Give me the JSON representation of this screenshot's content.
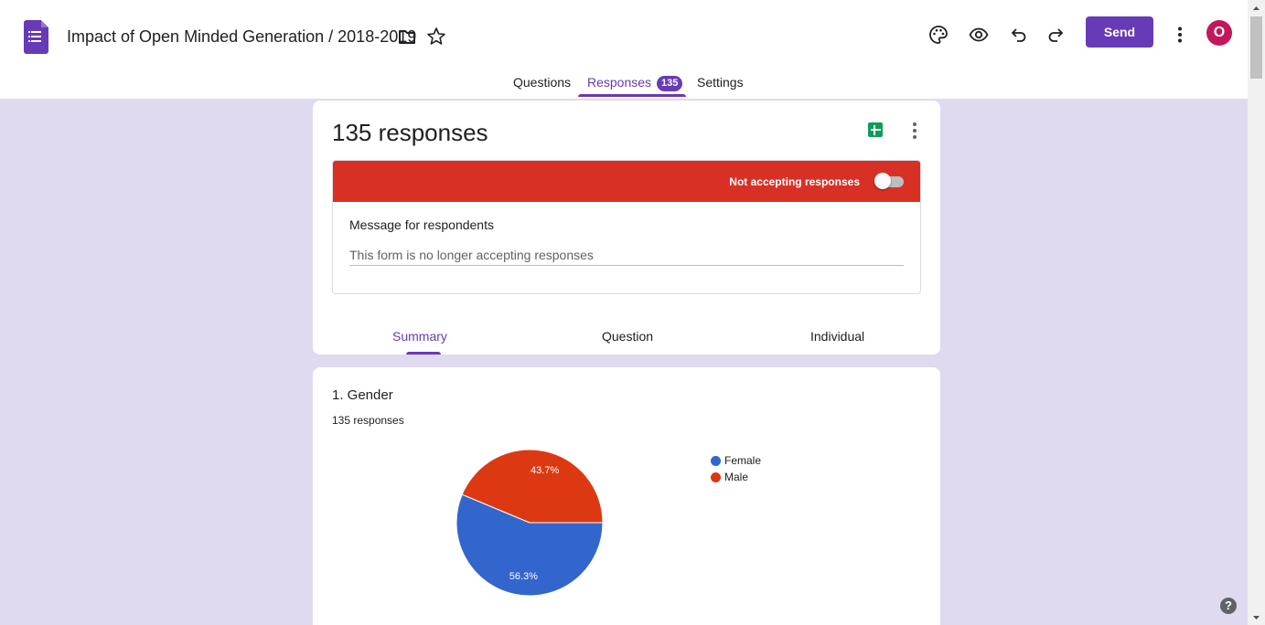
{
  "header": {
    "doc_title": "Impact of Open Minded Generation / 2018-2019",
    "send_label": "Send",
    "avatar_initial": "O"
  },
  "nav": {
    "tabs": [
      {
        "label": "Questions"
      },
      {
        "label": "Responses",
        "badge": "135"
      },
      {
        "label": "Settings"
      }
    ],
    "active_tab": "Responses"
  },
  "summary_card": {
    "title": "135 responses",
    "status_label": "Not accepting responses",
    "accepting": false,
    "message_label": "Message for respondents",
    "message_value": "This form is no longer accepting responses",
    "sub_tabs": [
      {
        "label": "Summary"
      },
      {
        "label": "Question"
      },
      {
        "label": "Individual"
      }
    ],
    "active_sub_tab": "Summary"
  },
  "question_card": {
    "title": "1. Gender",
    "response_count": "135 responses"
  },
  "chart_data": {
    "type": "pie",
    "categories": [
      "Female",
      "Male"
    ],
    "values": [
      56.3,
      43.7
    ],
    "data_labels": [
      "56.3%",
      "43.7%"
    ],
    "colors": [
      "#3366cc",
      "#dc3912"
    ],
    "legend_position": "right"
  },
  "colors": {
    "accent": "#673ab7",
    "banner_red": "#d93025",
    "background": "#e0daf0",
    "avatar": "#c2185b",
    "sheets_green": "#0f9d58"
  },
  "help_symbol": "?",
  "icons": {
    "header": [
      "forms-app-icon",
      "folder-icon",
      "star-icon",
      "palette-icon",
      "eye-icon",
      "undo-icon",
      "redo-icon",
      "more-vert-icon"
    ],
    "card": [
      "sheets-icon",
      "more-vert-icon"
    ]
  }
}
